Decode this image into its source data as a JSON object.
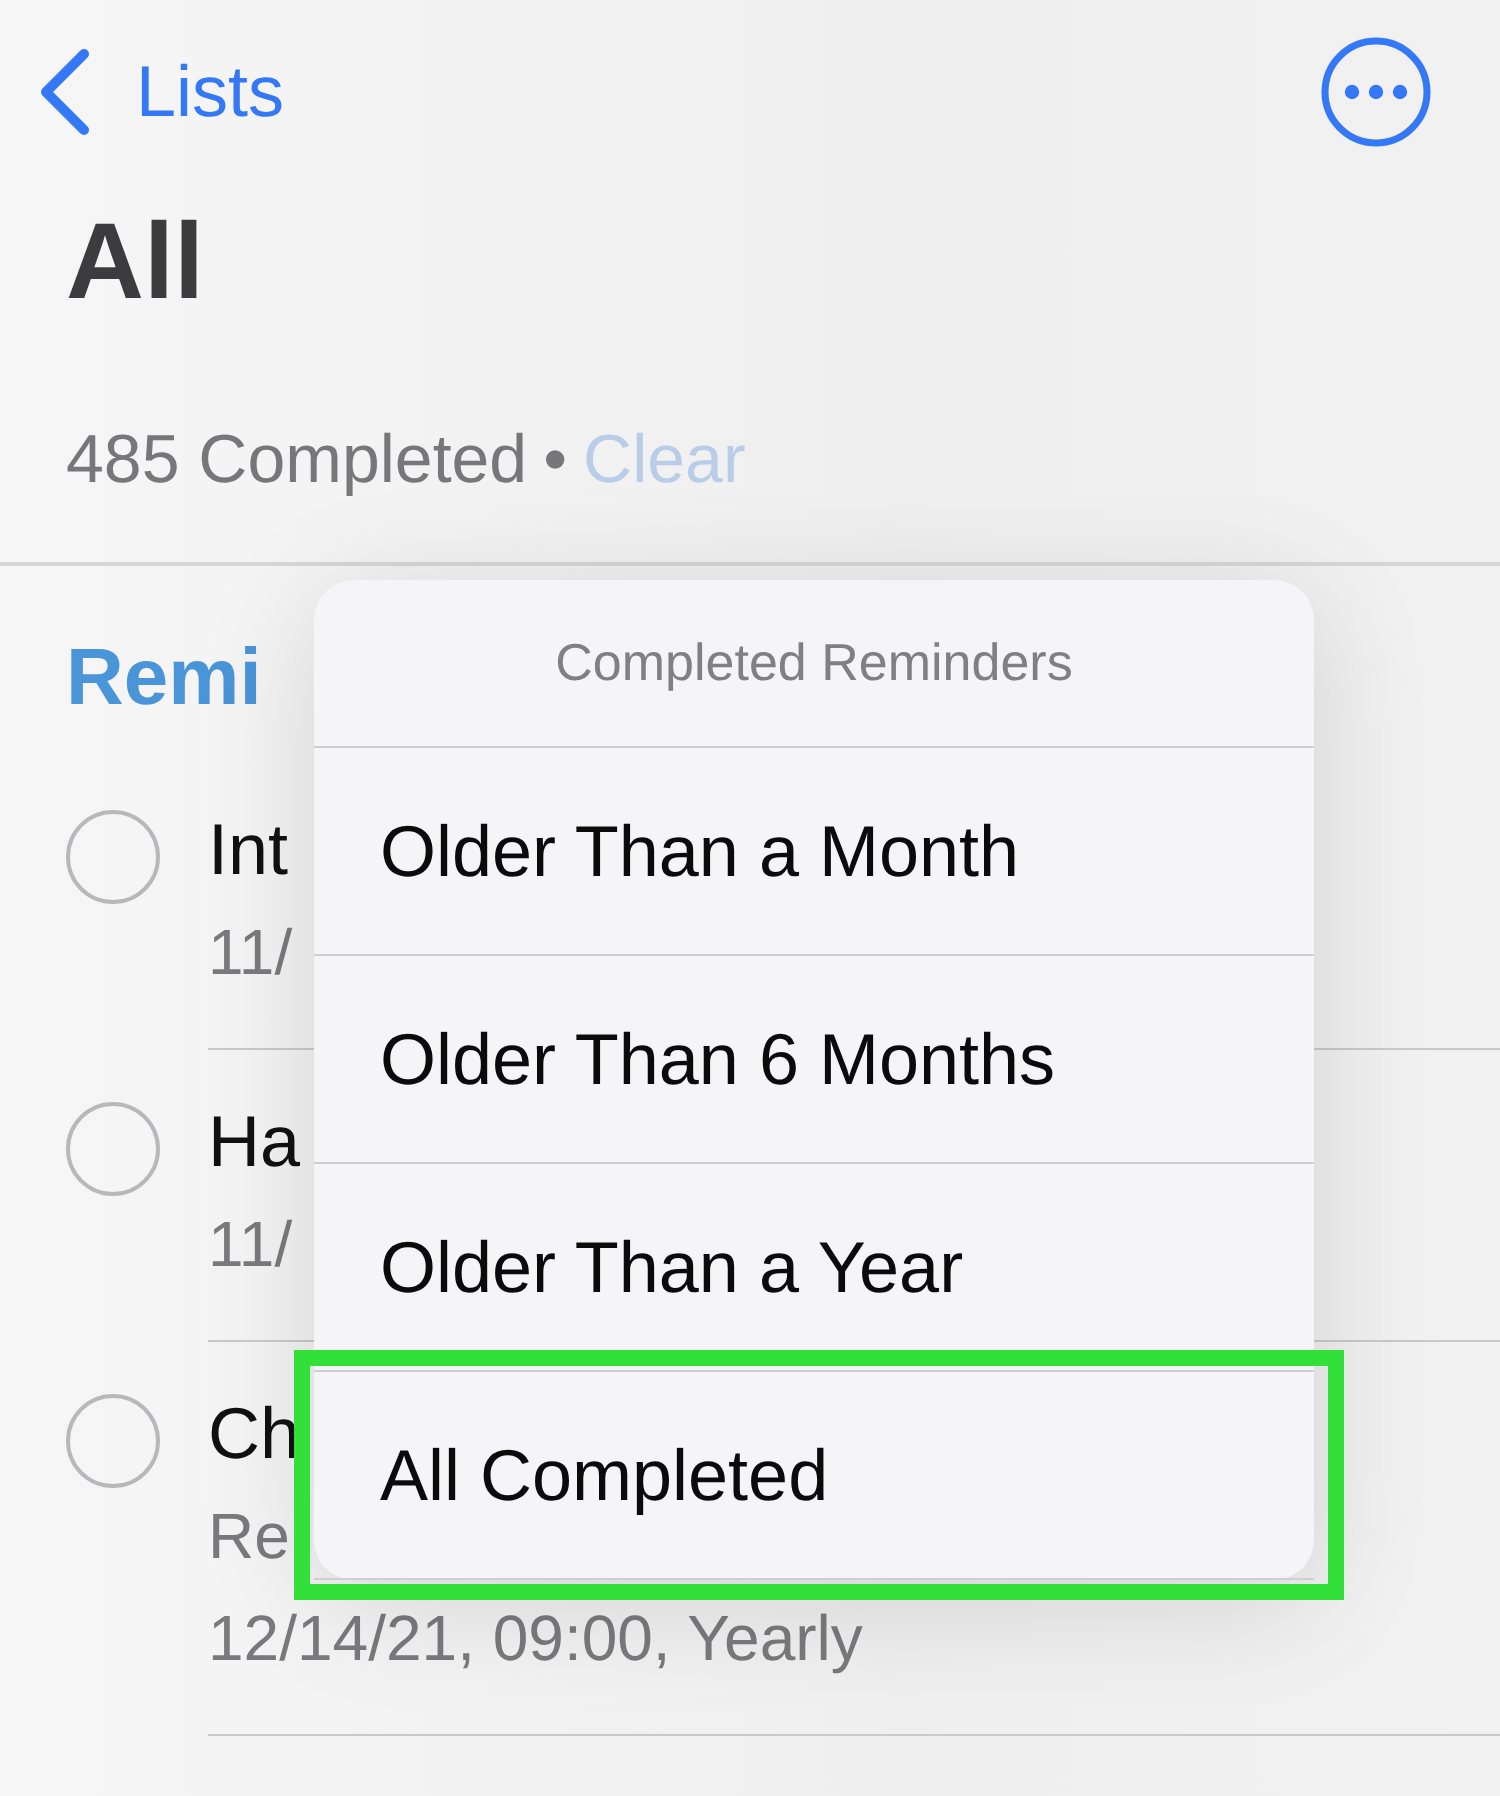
{
  "nav": {
    "back_label": "Lists"
  },
  "title": "All",
  "summary": {
    "completed": "485 Completed",
    "separator": "•",
    "action": "Clear"
  },
  "section": {
    "title": "Remi"
  },
  "reminders": [
    {
      "title": "Int",
      "checked": false,
      "lines": [
        "11/"
      ]
    },
    {
      "title": "Ha",
      "checked": false,
      "lines": [
        "11/"
      ]
    },
    {
      "title": "Ch",
      "checked": false,
      "lines": [
        "Re",
        "12/14/21, 09:00, Yearly"
      ]
    }
  ],
  "menu": {
    "title": "Completed Reminders",
    "items": [
      {
        "label": "Older Than a Month",
        "highlighted": false
      },
      {
        "label": "Older Than 6 Months",
        "highlighted": false
      },
      {
        "label": "Older Than a Year",
        "highlighted": false
      },
      {
        "label": "All Completed",
        "highlighted": true
      }
    ]
  }
}
